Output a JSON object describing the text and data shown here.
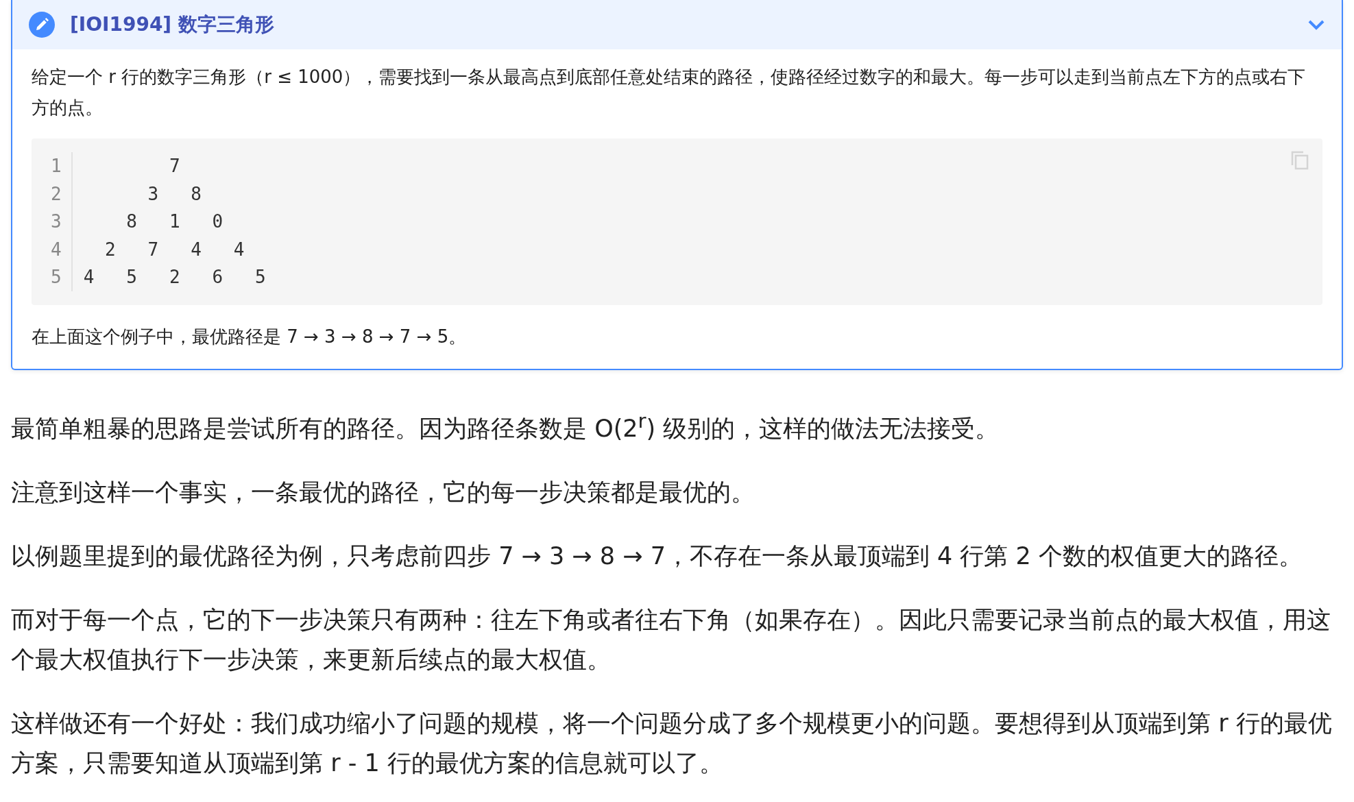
{
  "admonition": {
    "title": "[IOI1994] 数字三角形",
    "expanded": true,
    "intro": "给定一个 r 行的数字三角形（r ≤ 1000），需要找到一条从最高点到底部任意处结束的路径，使路径经过数字的和最大。每一步可以走到当前点左下方的点或右下方的点。",
    "code": {
      "line_numbers": [
        "1",
        "2",
        "3",
        "4",
        "5"
      ],
      "lines": [
        "        7",
        "      3   8",
        "    8   1   0",
        "  2   7   4   4",
        "4   5   2   6   5"
      ]
    },
    "outro": "在上面这个例子中，最优路径是 7 → 3 → 8 → 7 → 5。"
  },
  "paragraphs": [
    "最简单粗暴的思路是尝试所有的路径。因为路径条数是 O(2$^{r}$) 级别的，这样的做法无法接受。",
    "注意到这样一个事实，一条最优的路径，它的每一步决策都是最优的。",
    "以例题里提到的最优路径为例，只考虑前四步 7 → 3 → 8 → 7，不存在一条从最顶端到 4 行第 2 个数的权值更大的路径。",
    "而对于每一个点，它的下一步决策只有两种：往左下角或者往右下角（如果存在）。因此只需要记录当前点的最大权值，用这个最大权值执行下一步决策，来更新后续点的最大权值。",
    "这样做还有一个好处：我们成功缩小了问题的规模，将一个问题分成了多个规模更小的问题。要想得到从顶端到第 r 行的最优方案，只需要知道从顶端到第 r -  1 行的最优方案的信息就可以了。"
  ]
}
